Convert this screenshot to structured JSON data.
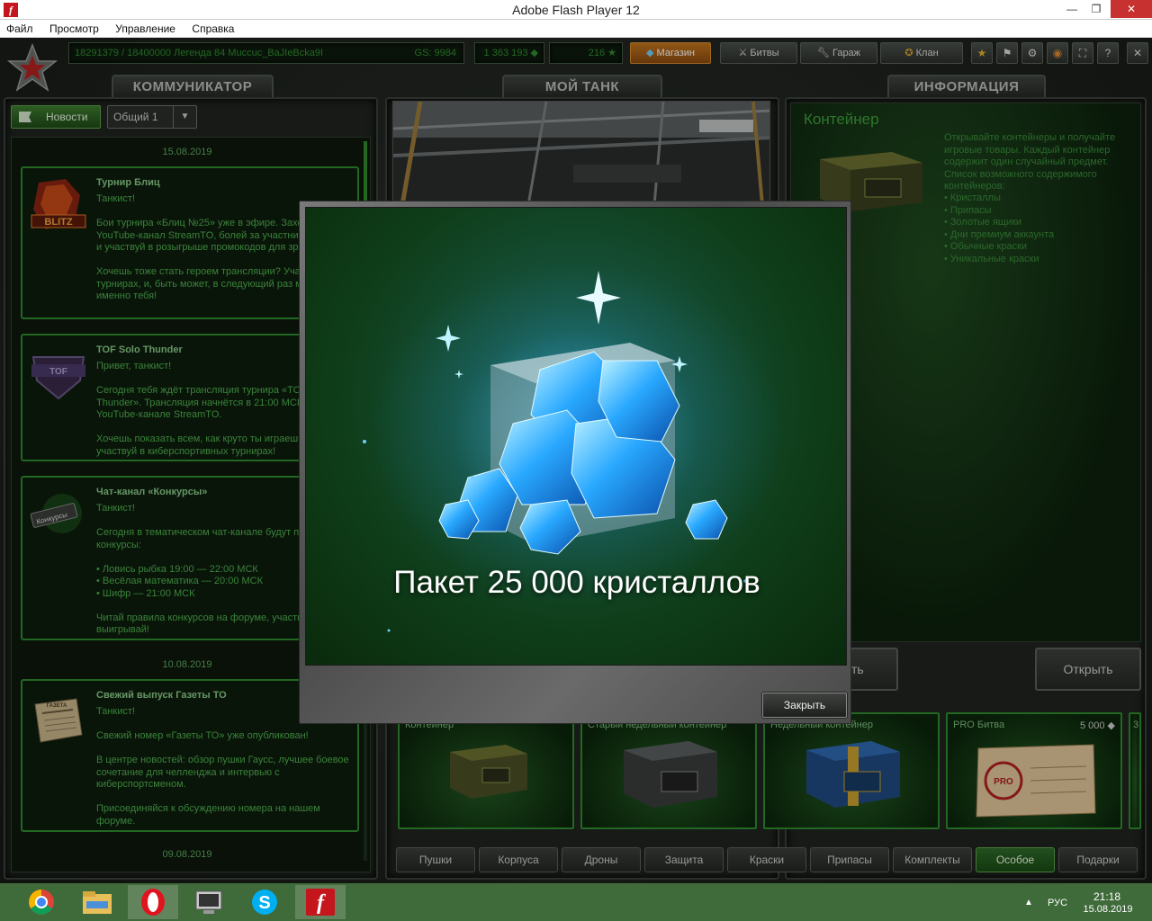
{
  "window": {
    "title": "Adobe Flash Player 12",
    "app_icon_glyph": "f",
    "minimize": "—",
    "maximize": "❐",
    "close": "✕"
  },
  "menu": [
    "Файл",
    "Просмотр",
    "Управление",
    "Справка"
  ],
  "topbar": {
    "player_info": "18291379 / 18400000  Легенда 84 Мuccuc_BaJIeBcka9I",
    "gs": "GS: 9984",
    "crystals": "1 363 193 ◆",
    "stars": "216 ★",
    "shop": "Магазин",
    "battles": "Битвы",
    "garage": "Гараж",
    "clan": "Клан",
    "icons": [
      "star-icon",
      "missions-icon",
      "settings-icon",
      "sound-icon",
      "fullscreen-icon",
      "help-icon",
      "close-icon"
    ],
    "icon_glyphs": [
      "★",
      "⚑",
      "⚙",
      "◉",
      "⛶",
      "?",
      "✕"
    ]
  },
  "tabs": {
    "communicator": "КОММУНИКАТОР",
    "my_tank": "МОЙ ТАНК",
    "info": "ИНФОРМАЦИЯ"
  },
  "communicator": {
    "news_button": "Новости",
    "channel": "Общий 1",
    "dates": [
      "15.08.2019",
      "10.08.2019",
      "09.08.2019"
    ],
    "news": [
      {
        "title": "Турнир Блиц",
        "text": "Танкист!\n\nБои турнира «Блиц №25» уже в эфире. Заходи на YouTube-канал StreamTO, болей за участников турнира и участвуй в розыгрыше промокодов для зрителей.\n\nХочешь тоже стать героем трансляции? Участвуй в турнирах, и, быть может, в следующий раз мы увидим именно тебя!"
      },
      {
        "title": "TOF Solo Thunder",
        "text": "Привет, танкист!\n\n Сегодня тебя ждёт трансляция турнира «TOF Solo Thunder». Трансляция начнётся в 21:00 МСК на YouTube-канале StreamTO.\n\nХочешь показать всем, как круто ты играешь? Тогда участвуй в киберспортивных турнирах!"
      },
      {
        "title": "Чат-канал «Конкурсы»",
        "text": "Танкист!\n\nСегодня в тематическом чат-канале будут проходить конкурсы:\n\n• Ловись рыбка 19:00 — 22:00 МСК\n• Весёлая математика — 20:00 МСК\n• Шифр — 21:00 МСК\n\nЧитай правила конкурсов на форуме, участвуй и выигрывай!"
      },
      {
        "title": "Свежий выпуск Газеты ТО",
        "text": "Танкист!\n\n Свежий номер «Газеты ТО» уже опубликован!\n\n В центре новостей: обзор пушки Гаусс, лучшее боевое сочетание для челленджа и интервью с киберспортсменом.\n\nПрисоединяйся к обсуждению номера на нашем форуме."
      }
    ],
    "thumb_labels": [
      "BLITZ",
      "TOF",
      "Конкурсы",
      "ГАЗЕТА"
    ]
  },
  "info": {
    "title": "Контейнер",
    "description": "Открывайте контейнеры и получайте игровые товары. Каждый контейнер содержит один случайный предмет. Список возможного содержимого контейнеров:",
    "contents": [
      "• Кристаллы",
      "• Припасы",
      "• Золотые ящики",
      "• Дни премиум аккаунта",
      "• Обычные краски",
      "• Уникальные краски"
    ],
    "partial_button": "ть",
    "open_button": "Открыть"
  },
  "shop_items": [
    {
      "label": "Контейнер",
      "price": ""
    },
    {
      "label": "Старый недельный контейнер",
      "price": ""
    },
    {
      "label": "Недельный контейнер",
      "price": ""
    },
    {
      "label": "PRO Битва",
      "price": "5 000 ◆"
    }
  ],
  "shop_overflow": "3",
  "categories": [
    "Пушки",
    "Корпуса",
    "Дроны",
    "Защита",
    "Краски",
    "Припасы",
    "Комплекты",
    "Особое",
    "Подарки"
  ],
  "active_category": "Особое",
  "modal": {
    "title": "Пакет 25 000 кристаллов",
    "close_button": "Закрыть"
  },
  "taskbar": {
    "apps": [
      "chrome-icon",
      "file-explorer-icon",
      "opera-icon",
      "computer-icon",
      "skype-icon",
      "flash-player-icon"
    ],
    "tray_arrow": "▲",
    "language": "РУС",
    "time": "21:18",
    "date": "15.08.2019"
  },
  "colors": {
    "accent_green": "#2e8a2e",
    "shop_orange": "#c2741e",
    "crystal_blue": "#29a8ff",
    "taskbar": "#3f6a3a"
  }
}
